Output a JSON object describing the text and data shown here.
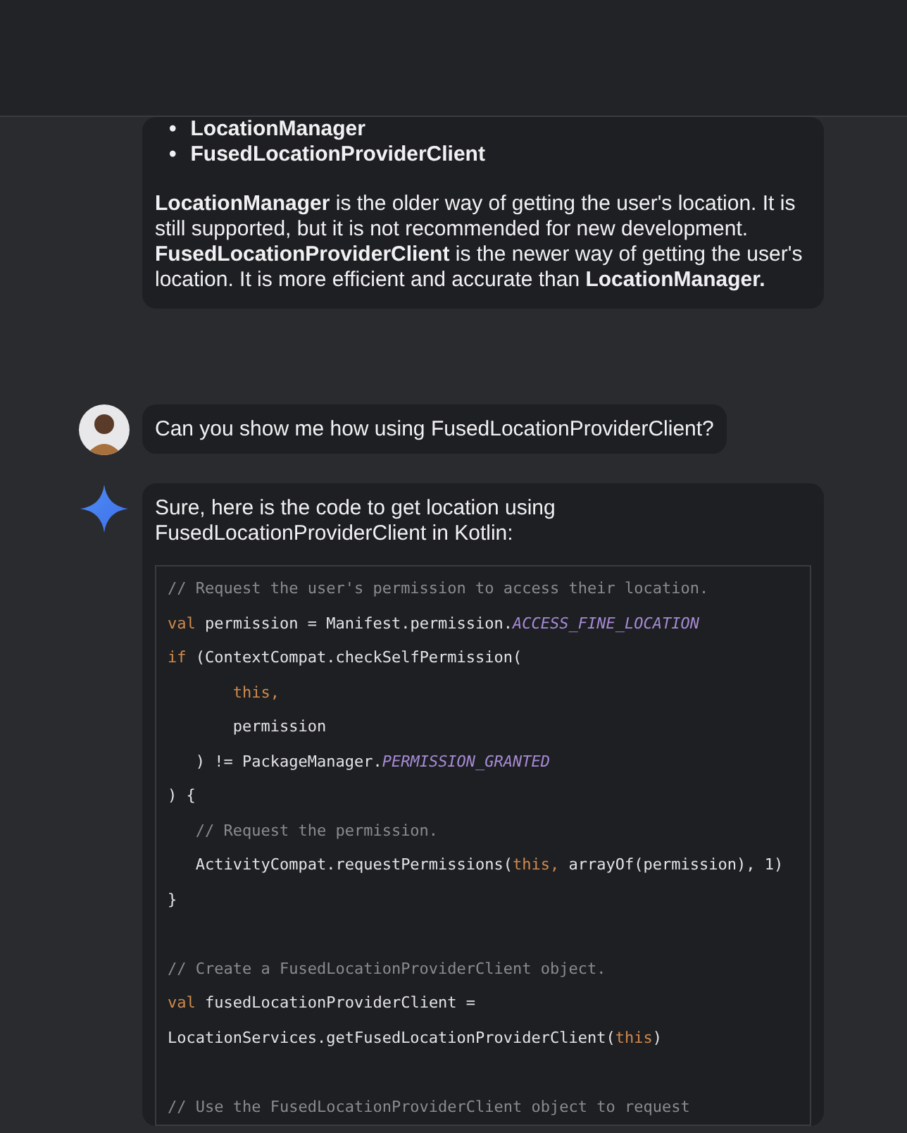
{
  "conversation": [
    {
      "kind": "assistant",
      "show_avatar": false,
      "bullets": [
        {
          "marker": "•",
          "text": "LocationManager"
        },
        {
          "marker": "•",
          "text": "FusedLocationProviderClient"
        }
      ],
      "paragraph": "**LocationManager** is the older way of getting the user's location. It is still supported, but it is not recommended for new development. **FusedLocationProviderClient** is the newer way of getting the user's location. It is more efficient and accurate than **LocationManager.**"
    },
    {
      "kind": "user",
      "show_avatar": true,
      "text": "Can you show me how using FusedLocationProviderClient?"
    },
    {
      "kind": "assistant",
      "show_avatar": true,
      "intro": "Sure, here is the code to get location using FusedLocationProviderClient in Kotlin:",
      "code": [
        {
          "kind": "code",
          "tokens": [
            {
              "text": "// Request the user's permission to access their location.",
              "kind": "comment"
            }
          ]
        },
        {
          "kind": "code",
          "tokens": [
            {
              "text": "val",
              "kind": "keyword"
            },
            {
              "text": " permission = Manifest.permission.",
              "kind": "plain"
            },
            {
              "text": "ACCESS_FINE_LOCATION",
              "kind": "constant"
            }
          ]
        },
        {
          "kind": "code",
          "tokens": [
            {
              "text": "if",
              "kind": "keyword"
            },
            {
              "text": " (ContextCompat.checkSelfPermission(",
              "kind": "plain"
            }
          ]
        },
        {
          "kind": "code",
          "tokens": [
            {
              "text": "       this,",
              "kind": "keyword"
            }
          ]
        },
        {
          "kind": "code",
          "tokens": [
            {
              "text": "       permission",
              "kind": "plain"
            }
          ]
        },
        {
          "kind": "code",
          "tokens": [
            {
              "text": "   ) != PackageManager.",
              "kind": "plain"
            },
            {
              "text": "PERMISSION_GRANTED",
              "kind": "constant"
            }
          ]
        },
        {
          "kind": "code",
          "tokens": [
            {
              "text": ") {",
              "kind": "plain"
            }
          ]
        },
        {
          "kind": "code",
          "tokens": [
            {
              "text": "   // Request the permission.",
              "kind": "comment"
            }
          ]
        },
        {
          "kind": "code",
          "tokens": [
            {
              "text": "   ActivityCompat.requestPermissions(",
              "kind": "plain"
            },
            {
              "text": "this,",
              "kind": "keyword"
            },
            {
              "text": " arrayOf(permission), 1)",
              "kind": "plain"
            }
          ]
        },
        {
          "kind": "code",
          "tokens": [
            {
              "text": "}",
              "kind": "plain"
            }
          ]
        },
        {
          "kind": "blank"
        },
        {
          "kind": "code",
          "tokens": [
            {
              "text": "// Create a FusedLocationProviderClient object.",
              "kind": "comment"
            }
          ]
        },
        {
          "kind": "code",
          "tokens": [
            {
              "text": "val",
              "kind": "keyword"
            },
            {
              "text": " fusedLocationProviderClient =",
              "kind": "plain"
            }
          ]
        },
        {
          "kind": "code",
          "tokens": [
            {
              "text": "LocationServices.getFusedLocationProviderClient(",
              "kind": "plain"
            },
            {
              "text": "this",
              "kind": "keyword"
            },
            {
              "text": ")",
              "kind": "plain"
            }
          ]
        },
        {
          "kind": "blank"
        },
        {
          "kind": "code",
          "tokens": [
            {
              "text": "// Use the FusedLocationProviderClient object to request",
              "kind": "comment"
            }
          ]
        }
      ]
    }
  ]
}
